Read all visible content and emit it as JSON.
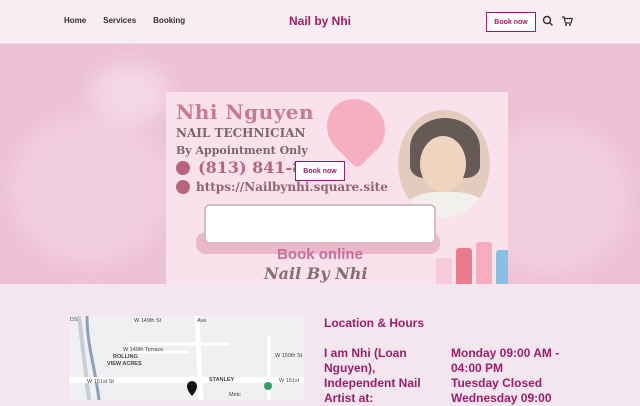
{
  "header": {
    "nav": [
      "Home",
      "Services",
      "Booking"
    ],
    "brand": "Nail by Nhi",
    "book_label": "Book now",
    "icons": [
      "search-icon",
      "cart-icon"
    ]
  },
  "hero": {
    "flyer": {
      "name": "Nhi Nguyen",
      "role": "NAIL TECHNICIAN",
      "appointment": "By Appointment Only",
      "phone": "(813) 841-8914",
      "website": "https://Nailbynhi.square.site",
      "signature": "Nail By Nhi"
    },
    "book_label": "Book now",
    "book_online": "Book online"
  },
  "map": {
    "labels": {
      "ds": "DS",
      "w149": "W 149th St",
      "w149t": "W 149th Terrace",
      "w150": "W 150th St",
      "rolling": "ROLLING",
      "view": "VIEW ACRES",
      "w151": "W 151st St",
      "stanley": "STANLEY",
      "w151b": "W 151st",
      "ave": "Ave",
      "metc": "Metc"
    }
  },
  "location": {
    "heading": "Location & Hours",
    "about_lines": [
      "I am Nhi (Loan",
      "Nguyen),",
      "Independent Nail",
      "Artist at:"
    ],
    "hours_lines": [
      "Monday 09:00 AM -",
      "04:00 PM",
      "Tuesday Closed",
      "Wednesday 09:00"
    ]
  },
  "colors": {
    "accent": "#9c1e6b",
    "hero_bg": "#e7a9c4",
    "page_bg": "#f4e6ef"
  }
}
